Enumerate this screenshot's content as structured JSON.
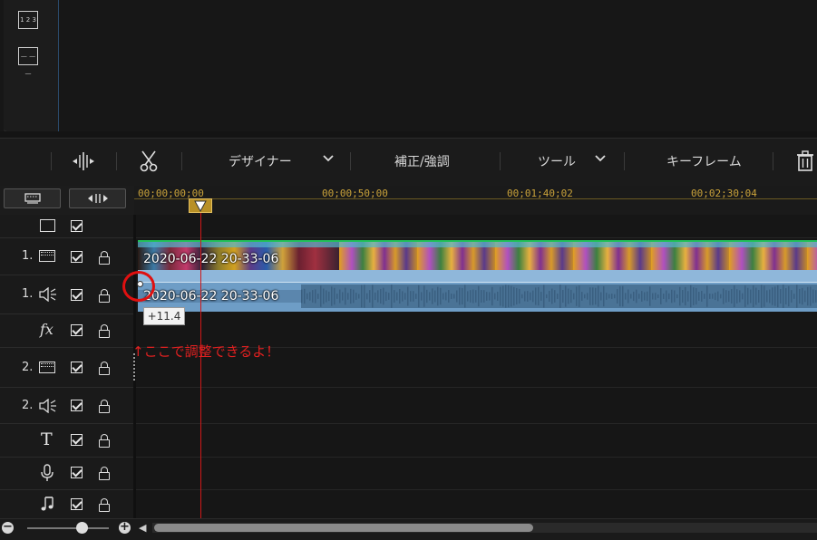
{
  "toolbar": {
    "designer_label": "デザイナー",
    "correction_label": "補正/強調",
    "tool_label": "ツール",
    "keyframe_label": "キーフレーム"
  },
  "ruler": {
    "ticks": [
      "00;00;00;00",
      "00;00;50;00",
      "00;01;40;02",
      "00;02;30;04"
    ]
  },
  "tracks": {
    "video1_num": "1.",
    "audio1_num": "1.",
    "fx_label": "fx",
    "video2_num": "2.",
    "audio2_num": "2.",
    "text_label": "T"
  },
  "clips": {
    "video_name": "2020-06-22 20-33-06",
    "audio_name": "2020-06-22 20-33-06"
  },
  "volume_tooltip": "+11.4",
  "annotation": "↑ここで調整できるよ！",
  "colors": {
    "playhead": "#d01818",
    "ruler_text": "#c9a23a",
    "audio_clip": "#6e9dc6",
    "video_clip_edge": "#23c05a",
    "annotation": "#e02020"
  },
  "icons": [
    "chapter-icon",
    "subtitle-icon",
    "split-icon",
    "scissors-icon",
    "chevron-down-icon",
    "trash-icon",
    "film-icon",
    "speaker-icon",
    "microphone-icon",
    "music-note-icon",
    "lock-icon",
    "checkbox-icon",
    "zoom-out-icon",
    "zoom-in-icon",
    "scroll-left-icon"
  ],
  "timeline_scroll": {
    "thumb_fraction": 0.57
  },
  "zoom_level_fraction": 0.6
}
